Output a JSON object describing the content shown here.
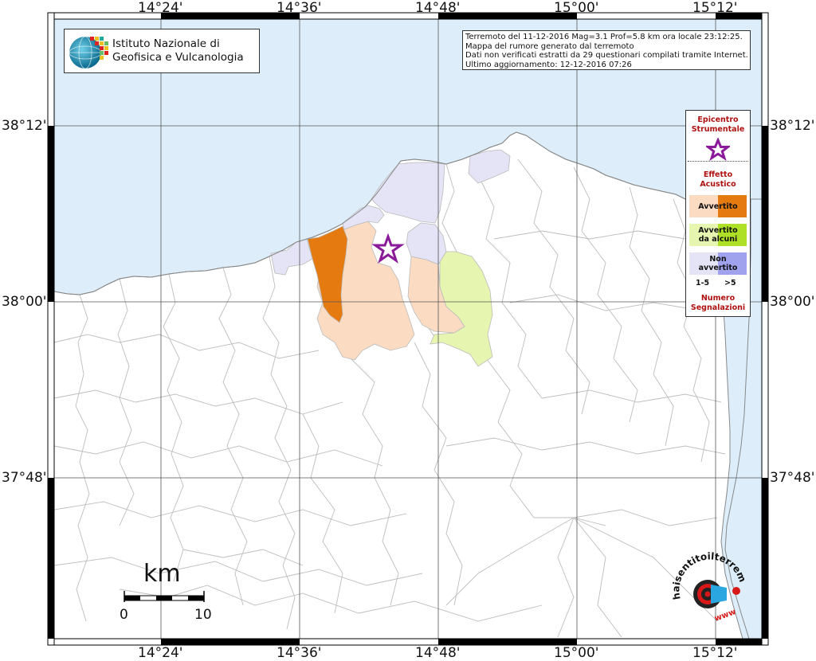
{
  "map": {
    "top_coordinates": [
      "14°24'",
      "14°36'",
      "14°48'",
      "15°00'",
      "15°12'"
    ],
    "bottom_coordinates": [
      "14°24'",
      "14°36'",
      "14°48'",
      "15°00'",
      "15°12'"
    ],
    "left_coordinates": [
      "38°12'",
      "38°00'",
      "37°48'"
    ],
    "right_coordinates": [
      "38°12'",
      "38°00'",
      "37°48'"
    ],
    "colors": {
      "sea": "#ddeefa",
      "land": "#ffffff",
      "light_orange": "#fbdcc2",
      "dark_orange": "#e57a10",
      "light_green": "#e6f5b0",
      "light_lavender": "#e4e4f6",
      "dark_blue": "#a0a2ee",
      "bright_green": "#aee028",
      "star": "#8a1a99"
    }
  },
  "logo": {
    "line1": "Istituto Nazionale di",
    "line2": "Geofisica e Vulcanologia"
  },
  "info": {
    "line1": "Terremoto del 11-12-2016 Mag=3.1 Prof=5.8 km ora locale 23:12:25.",
    "line2": "Mappa del rumore generato dal terremoto",
    "line3": "Dati non verificati estratti da 29 questionari compilati tramite Internet.",
    "line4": "Ultimo aggiornamento: 12-12-2016 07:26"
  },
  "legend": {
    "epicenter_line1": "Epicentro",
    "epicenter_line2": "Strumentale",
    "effect_line1": "Effetto",
    "effect_line2": "Acustico",
    "avvertito": "Avvertito",
    "avvertito_alcuni_line1": "Avvertito",
    "avvertito_alcuni_line2": "da alcuni",
    "non_avvertito_line1": "Non",
    "non_avvertito_line2": "avvertito",
    "range_low": "1-5",
    "range_high": ">5",
    "count_line1": "Numero",
    "count_line2": "Segnalazioni"
  },
  "scale": {
    "unit": "km",
    "start": "0",
    "end": "10"
  },
  "watermark": {
    "text": "haisentitoilterremoto.it",
    "sub": "www"
  }
}
